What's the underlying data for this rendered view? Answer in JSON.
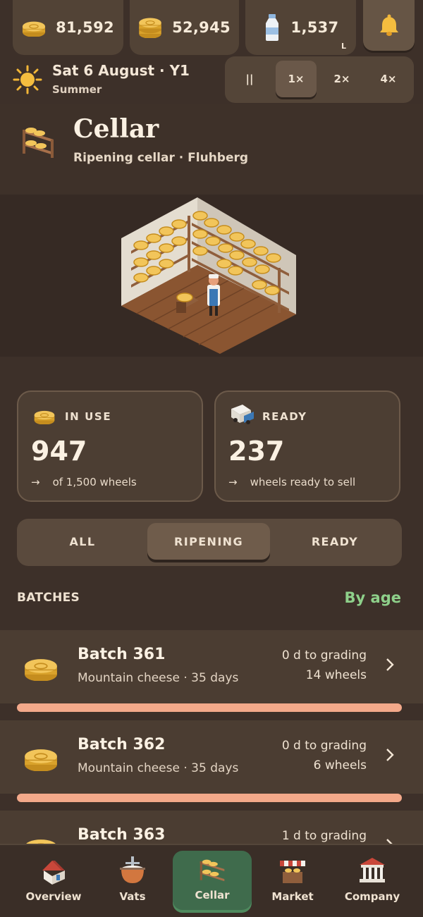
{
  "resources": [
    {
      "icon": "gold-coins-icon",
      "value": "81,592"
    },
    {
      "icon": "cheese-stack-icon",
      "value": "52,945"
    },
    {
      "icon": "milk-bottle-icon",
      "value": "1,537",
      "unit": "L"
    }
  ],
  "date": {
    "main": "Sat 6 August · Y1",
    "season": "Summer"
  },
  "speed": {
    "pause": "||",
    "options": [
      "1×",
      "2×",
      "4×"
    ],
    "selected": "1×"
  },
  "header": {
    "title": "Cellar",
    "subtitle": "Ripening cellar · Fluhberg"
  },
  "stats": {
    "in_use": {
      "label": "IN USE",
      "value": "947",
      "note": "of 1,500 wheels"
    },
    "ready": {
      "label": "READY",
      "value": "237",
      "note": "wheels ready to sell"
    }
  },
  "filter": {
    "tabs": [
      "ALL",
      "RIPENING",
      "READY"
    ],
    "selected": "RIPENING"
  },
  "batches_section": {
    "title": "BATCHES",
    "sort": "By age"
  },
  "batches": [
    {
      "name": "Batch 361",
      "type": "Mountain cheese · 35 days",
      "grading": "0 d to grading",
      "wheels": "14 wheels",
      "progress": 1.0
    },
    {
      "name": "Batch 362",
      "type": "Mountain cheese · 35 days",
      "grading": "0 d to grading",
      "wheels": "6 wheels",
      "progress": 1.0
    },
    {
      "name": "Batch 363",
      "type": "",
      "grading": "1 d to grading",
      "wheels": "",
      "progress": null
    }
  ],
  "nav": {
    "items": [
      {
        "label": "Overview",
        "icon": "house-icon"
      },
      {
        "label": "Vats",
        "icon": "vat-icon"
      },
      {
        "label": "Cellar",
        "icon": "cheese-shelf-icon"
      },
      {
        "label": "Market",
        "icon": "market-stall-icon"
      },
      {
        "label": "Company",
        "icon": "bank-building-icon"
      }
    ],
    "selected": "Cellar"
  },
  "colors": {
    "accent_green": "#8ed08a",
    "progress": "#f3a98a",
    "nav_active": "#3f6b4c",
    "background": "#3d3029"
  }
}
